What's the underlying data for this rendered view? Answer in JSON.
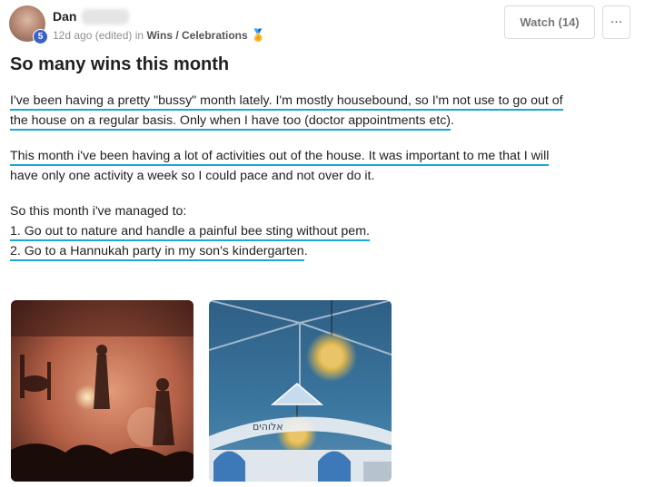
{
  "author": {
    "name": "Dan",
    "level": "5"
  },
  "meta": {
    "time": "12d ago (edited)",
    "in": "in",
    "category": "Wins / Celebrations"
  },
  "actions": {
    "watch_label": "Watch (14)",
    "more_label": "···"
  },
  "post": {
    "title": "So many wins this month",
    "p1_line1": "I've been having a pretty \"bussy\" month lately. I'm mostly housebound, so I'm not use to go out of",
    "p1_line2": "the house on a regular basis. Only when I have too (doctor appointments etc)",
    "p1_end": ".",
    "p2_line1": "This month i've been having a lot of activities out of the house. It was important to me that I will",
    "p2_line2": "have only one activity a week so I could pace and not over do it.",
    "list_intro": "So this month i've managed to:",
    "list_item1": "1. Go out to nature and handle a painful bee sting without pem.",
    "list_item2": "2. Go to a Hannukah party in my son's kindergarten",
    "list_item2_end": "."
  },
  "photos": {
    "photo2_sign": "אלוהים"
  },
  "colors": {
    "highlight": "#1aa6d6",
    "badge": "#3b63c4",
    "medal": "#d4a017"
  },
  "icons": {
    "badge": "level-badge",
    "medal": "medal-icon",
    "more": "more-icon"
  }
}
